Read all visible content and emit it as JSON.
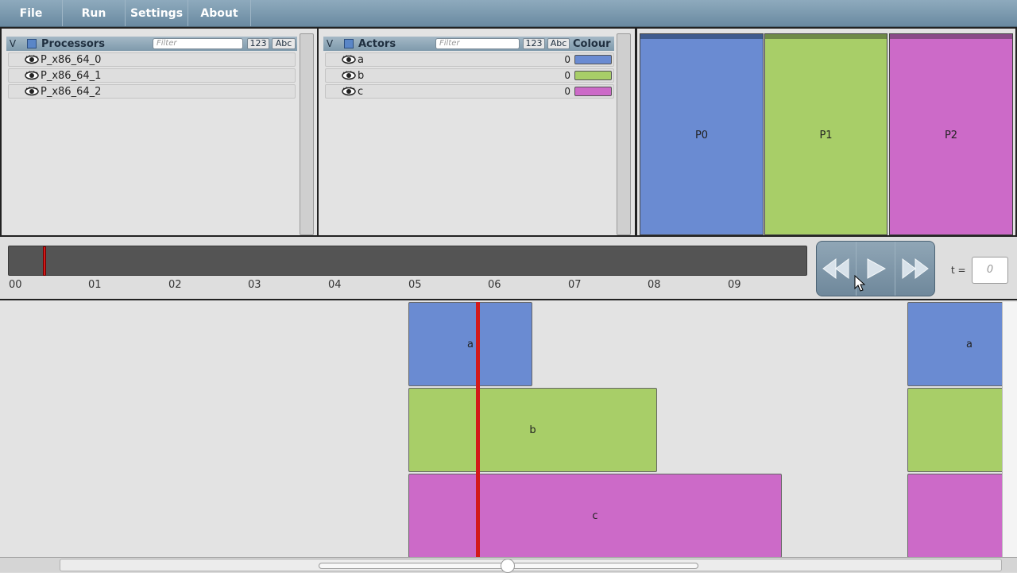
{
  "menu": {
    "file": "File",
    "run": "Run",
    "settings": "Settings",
    "about": "About"
  },
  "processors": {
    "title": "Processors",
    "filter_placeholder": "Filter",
    "num_btn": "123",
    "abc_btn": "Abc",
    "items": [
      "P_x86_64_0",
      "P_x86_64_1",
      "P_x86_64_2"
    ]
  },
  "actors": {
    "title": "Actors",
    "filter_placeholder": "Filter",
    "num_btn": "123",
    "abc_btn": "Abc",
    "colour_header": "Colour",
    "items": [
      {
        "name": "a",
        "count": "0",
        "colour": "#6a8bd2"
      },
      {
        "name": "b",
        "count": "0",
        "colour": "#a8ce68"
      },
      {
        "name": "c",
        "count": "0",
        "colour": "#cc6ac8"
      }
    ]
  },
  "visual": {
    "processors": [
      {
        "label": "P0",
        "colour": "#6a8bd2",
        "top": "#3f5b8e"
      },
      {
        "label": "P1",
        "colour": "#a8ce68",
        "top": "#6f8a48"
      },
      {
        "label": "P2",
        "colour": "#cc6ac8",
        "top": "#8a4a88"
      }
    ]
  },
  "timeline": {
    "ticks": [
      "00",
      "01",
      "02",
      "03",
      "04",
      "05",
      "06",
      "07",
      "08",
      "09"
    ],
    "t_label": "t =",
    "t_value": "0",
    "controls": [
      "rewind-button",
      "play-button",
      "fast-forward-button"
    ]
  },
  "gantt": {
    "bars": [
      {
        "label": "a"
      },
      {
        "label": "b"
      },
      {
        "label": "c"
      },
      {
        "label": "a"
      },
      {
        "label": ""
      },
      {
        "label": ""
      }
    ]
  }
}
